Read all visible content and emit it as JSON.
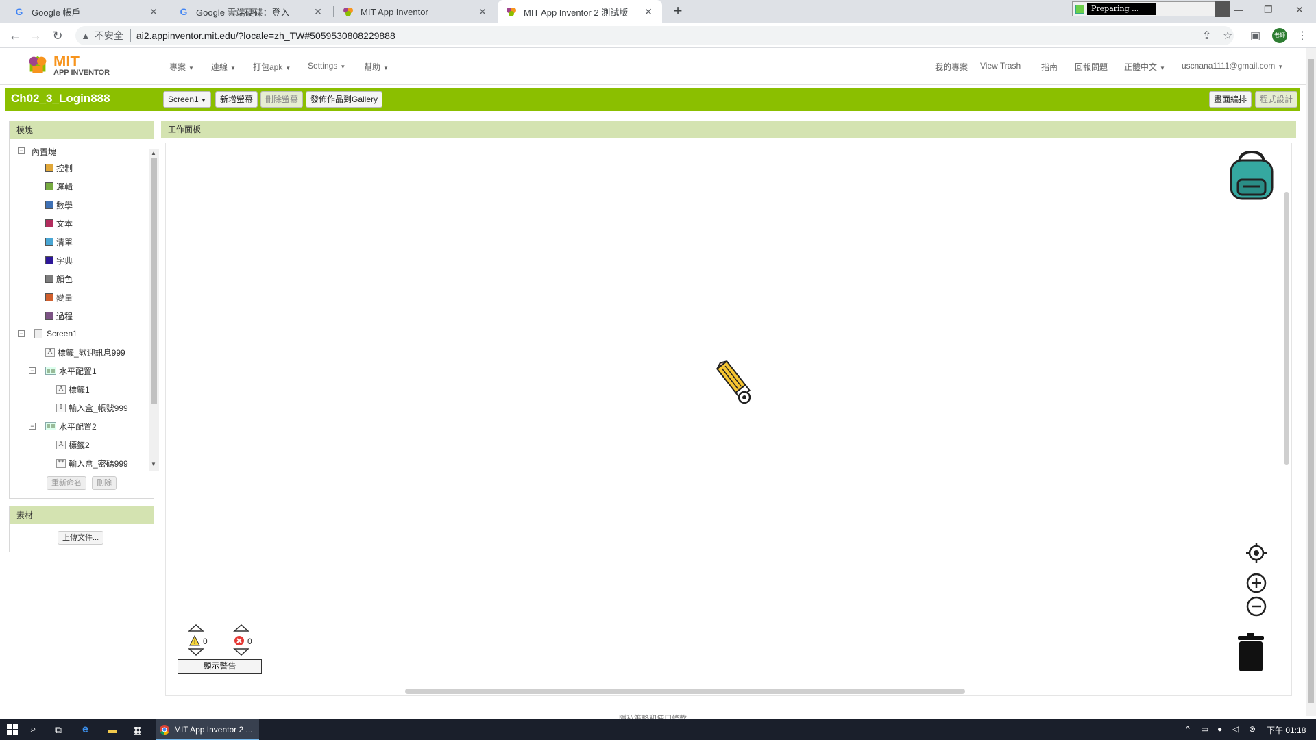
{
  "browser": {
    "tabs": [
      {
        "title": "Google 帳戶",
        "icon": "google-icon",
        "close": "✕"
      },
      {
        "title": "Google 雲端硬碟：登入",
        "icon": "google-icon",
        "close": "✕"
      },
      {
        "title": "MIT App Inventor",
        "icon": "mit-icon",
        "close": "✕"
      },
      {
        "title": "MIT App Inventor 2 測試版",
        "icon": "mit-icon",
        "close": "✕",
        "active": true
      }
    ],
    "new_tab": "+",
    "preparing_text": "Preparing ...",
    "address": {
      "security_label": "不安全",
      "url": "ai2.appinventor.mit.edu/?locale=zh_TW#5059530808229888"
    },
    "profile_label": "老師"
  },
  "app_header": {
    "logo_mit": "MIT",
    "logo_sub": "APP INVENTOR",
    "menus": [
      "專案",
      "連線",
      "打包apk",
      "Settings",
      "幫助"
    ],
    "right_links": [
      "我的專案",
      "View Trash",
      "指南",
      "回報問題",
      "正體中文",
      "uscnana1111@gmail.com"
    ]
  },
  "project_bar": {
    "name": "Ch02_3_Login888",
    "screen_selector": "Screen1",
    "add_screen": "新增螢幕",
    "remove_screen": "刪除螢幕",
    "publish_gallery": "發佈作品到Gallery",
    "designer": "畫面編排",
    "blocks": "程式設計"
  },
  "blocks_panel": {
    "title": "模塊",
    "builtin_label": "內置塊",
    "builtin": [
      {
        "label": "控制",
        "color": "#e1a83a"
      },
      {
        "label": "邏輯",
        "color": "#77ab41"
      },
      {
        "label": "數學",
        "color": "#3f71b5"
      },
      {
        "label": "文本",
        "color": "#b32d5e"
      },
      {
        "label": "清單",
        "color": "#49a6d4"
      },
      {
        "label": "字典",
        "color": "#2d1799"
      },
      {
        "label": "顏色",
        "color": "#7d7d7d"
      },
      {
        "label": "變量",
        "color": "#d05f2d"
      },
      {
        "label": "過程",
        "color": "#7c5385"
      }
    ],
    "screen": "Screen1",
    "components": {
      "label_welcome": "標籤_歡迎訊息999",
      "horiz1": "水平配置1",
      "label1": "標籤1",
      "input_account": "輸入盒_帳號999",
      "horiz2": "水平配置2",
      "label2": "標籤2",
      "input_password": "輸入盒_密碼999"
    },
    "rename": "重新命名",
    "delete": "刪除"
  },
  "media_panel": {
    "title": "素材",
    "upload": "上傳文件..."
  },
  "workspace": {
    "title": "工作面板",
    "warnings_count": "0",
    "errors_count": "0",
    "show_warnings": "顯示警告"
  },
  "footer": "隱私策略和使用條款",
  "taskbar": {
    "app_label": "MIT App Inventor 2 ...",
    "clock": "下午 01:18"
  }
}
